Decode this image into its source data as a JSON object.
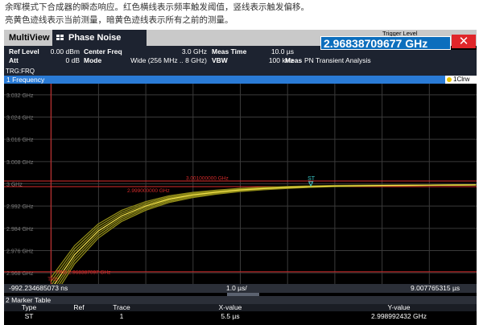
{
  "captions": {
    "line1": "余晖模式下合成器的瞬态响应。红色横线表示频率触发阈值，竖线表示触发偏移。",
    "line2": "亮黄色迹线表示当前测量，暗黄色迹线表示所有之前的测量。"
  },
  "toolbar": {
    "multiview_label": "MultiView",
    "phase_noise_label": "Phase Noise",
    "trigger_level_label": "Trigger Level",
    "trigger_level_value": "2.96838709677 GHz",
    "close_label": "✕"
  },
  "settings": {
    "ref_level_label": "Ref Level",
    "ref_level_value": "0.00 dBm",
    "att_label": "Att",
    "att_value": "0 dB",
    "center_freq_label": "Center Freq",
    "center_freq_value": "3.0 GHz",
    "mode_label": "Mode",
    "mode_value": "Wide (256 MHz .. 8 GHz)",
    "meas_time_label": "Meas Time",
    "meas_time_value": "10.0 µs",
    "vbw_label": "VBW",
    "vbw_value": "100 kHz",
    "meas_label": "Meas",
    "meas_value": "PN Transient Analysis"
  },
  "trace_bar": {
    "text": "TRG:FRQ"
  },
  "diagram": {
    "title": "1 Frequency",
    "badge": "1Clrw",
    "yticks": [
      "3.032 GHz",
      "3.024 GHz",
      "3.016 GHz",
      "3.008 GHz",
      "3 GHz",
      "2.992 GHz",
      "2.984 GHz",
      "2.976 GHz",
      "2.968 GHz"
    ],
    "upper_line_label": "3.001000000 GHz",
    "lower_line_label": "2.999000000 GHz",
    "trigger_line_label": "TRG 2.968387097 GHz",
    "trg_marker_label": "TRG",
    "marker_label": "ST"
  },
  "xaxis": {
    "start": "-992.234685073 ns",
    "division": "1.0 µs/",
    "stop": "9.007765315 µs"
  },
  "marker_table": {
    "title": "2 Marker Table",
    "columns": [
      "Type",
      "Ref",
      "Trace",
      "X-value",
      "Y-value"
    ],
    "rows": [
      {
        "type": "ST",
        "ref": "",
        "trace": "1",
        "x": "5.5 µs",
        "y": "2.998992432 GHz"
      }
    ]
  },
  "colors": {
    "trace_bright": "#f3e24a",
    "trace_dim": "#8f8a18",
    "limit_red": "#d92b2b",
    "header_blue": "#2a7bd6",
    "trigger_box": "#0c6ebd"
  },
  "chart_data": {
    "type": "line",
    "xlim": [
      -0.992234685073,
      9.007765315
    ],
    "x_unit": "µs",
    "ylim": [
      2.964,
      3.036
    ],
    "y_unit": "GHz",
    "grid": true,
    "trigger_level": 2.968387097,
    "trigger_offset_x": 0,
    "upper_line": 3.001,
    "lower_line": 2.999,
    "marker": {
      "label": "ST",
      "x": 5.5,
      "y": 2.998992432
    },
    "series": [
      {
        "x": [
          0,
          0.5,
          1.0,
          1.5,
          2.0,
          2.5,
          3.0,
          3.5,
          4.0,
          4.5,
          5.0,
          5.5,
          6.0,
          7.0,
          8.0,
          9.0
        ],
        "y": [
          2.962,
          2.9745,
          2.983,
          2.9885,
          2.992,
          2.9945,
          2.996,
          2.997,
          2.9978,
          2.9983,
          2.9987,
          2.99899,
          2.9992,
          2.9994,
          2.9995,
          2.9996
        ]
      }
    ]
  }
}
